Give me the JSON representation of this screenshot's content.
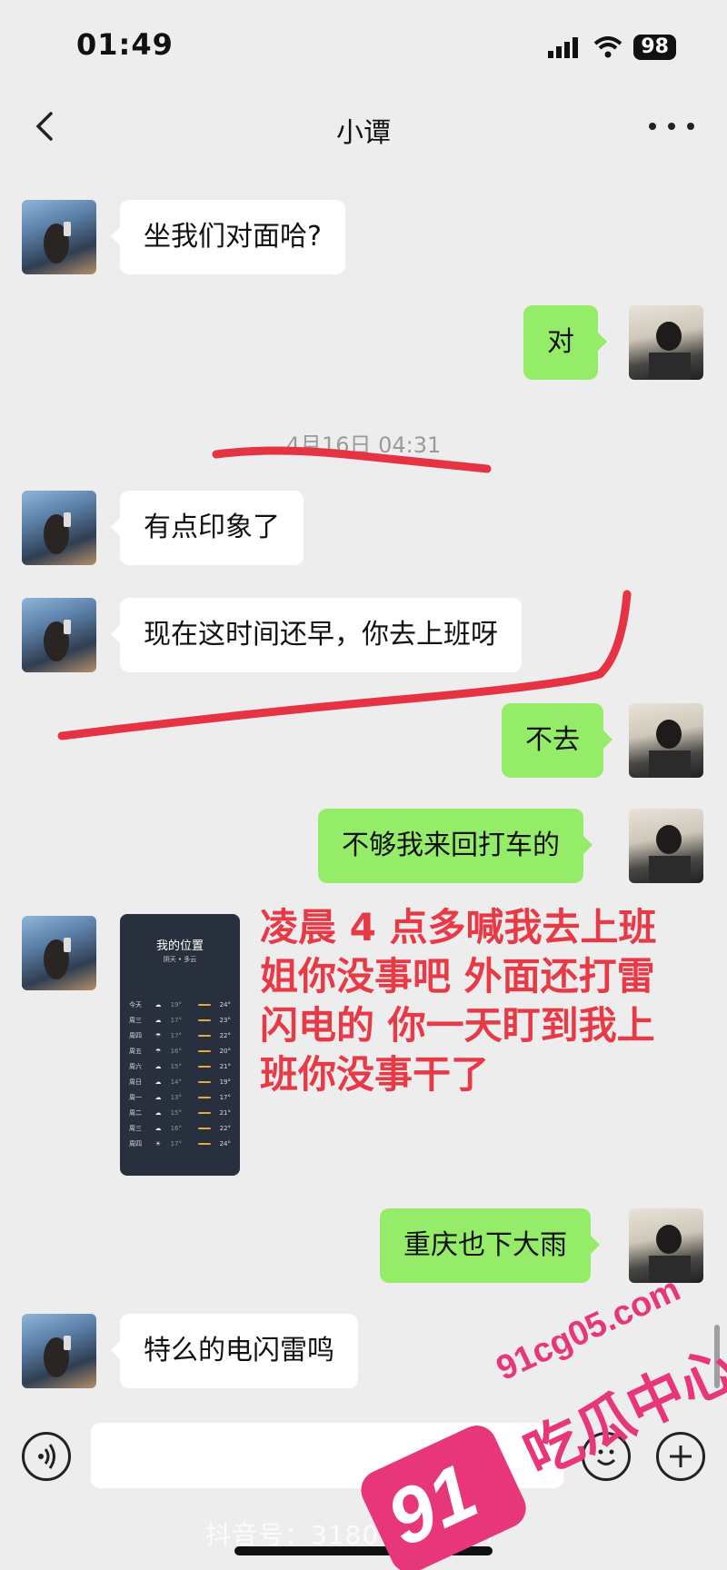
{
  "status_bar": {
    "time": "01:49",
    "battery": "98"
  },
  "nav": {
    "title": "小谭"
  },
  "messages": {
    "m1": "坐我们对面哈?",
    "m2": "对",
    "timestamp": "4月16日 04:31",
    "m3": "有点印象了",
    "m4": "现在这时间还早，你去上班呀",
    "m5": "不去",
    "m6": "不够我来回打车的",
    "m7": "重庆也下大雨",
    "m8": "特么的电闪雷鸣"
  },
  "weather_image": {
    "title": "我的位置",
    "subtitle": "阴天 • 多云",
    "rows": [
      {
        "day": "今天",
        "icon": "☁",
        "low": "19°",
        "high": "24°"
      },
      {
        "day": "周三",
        "icon": "☁",
        "low": "17°",
        "high": "23°"
      },
      {
        "day": "周四",
        "icon": "☂",
        "low": "17°",
        "high": "22°"
      },
      {
        "day": "周五",
        "icon": "☂",
        "low": "16°",
        "high": "20°"
      },
      {
        "day": "周六",
        "icon": "☁",
        "low": "15°",
        "high": "21°"
      },
      {
        "day": "周日",
        "icon": "☁",
        "low": "14°",
        "high": "19°"
      },
      {
        "day": "周一",
        "icon": "☁",
        "low": "13°",
        "high": "17°"
      },
      {
        "day": "周二",
        "icon": "☁",
        "low": "15°",
        "high": "21°"
      },
      {
        "day": "周三",
        "icon": "☁",
        "low": "16°",
        "high": "22°"
      },
      {
        "day": "周四",
        "icon": "☀",
        "low": "17°",
        "high": "24°"
      }
    ]
  },
  "annotation": {
    "line1": "凌晨 4 点多喊我去上班",
    "line2": "姐你没事吧 外面还打雷",
    "line3": "闪电的 你一天盯到我上",
    "line4": "班你没事干了"
  },
  "footer": {
    "douyin": "抖音号：31800188787"
  },
  "watermark": {
    "number": "91",
    "url": "91cg05.com",
    "name": "吃瓜中心"
  },
  "colors": {
    "bubble_right": "#95ec69",
    "bubble_left": "#ffffff",
    "annotation": "#e83a46",
    "watermark": "#e8367a"
  }
}
